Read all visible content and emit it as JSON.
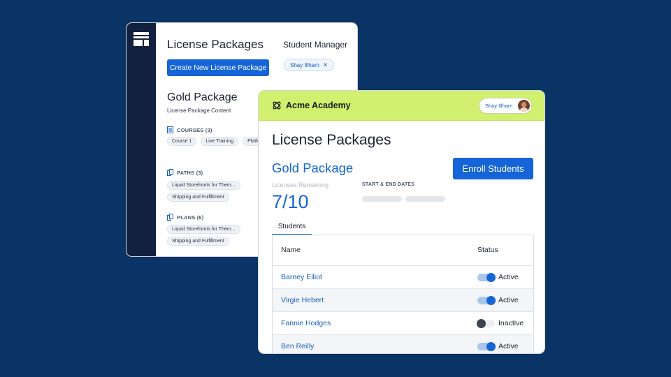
{
  "back_window": {
    "title": "License Packages",
    "create_button": "Create New License Package",
    "manager_label": "Student Manager",
    "manager_chip": "Shay Illham",
    "chip_remove_icon": "close-icon",
    "package_title": "Gold Package",
    "package_subtitle": "License Package Content",
    "sections": [
      {
        "label": "COURSES (3)",
        "icon": "document-icon",
        "items": [
          "Course 1",
          "Live Training",
          "Platform"
        ]
      },
      {
        "label": "PATHS (3)",
        "icon": "stack-icon",
        "items": [
          "Liquid Storefronts for Them...",
          "Shipping and Fulfillment"
        ]
      },
      {
        "label": "PLANS (6)",
        "icon": "stack-icon",
        "items": [
          "Liquid Storefronts for Them...",
          "Shipping and Fulfillment"
        ]
      }
    ]
  },
  "front_window": {
    "brand": "Acme Academy",
    "user_name": "Shay Illham",
    "page_title": "License Packages",
    "package_title": "Gold Package",
    "enroll_button": "Enroll Students",
    "licenses_label": "Licenses Remaining",
    "licenses_count": "7/10",
    "dates_label": "START & END DATES",
    "tab_label": "Students",
    "table": {
      "headers": {
        "name": "Name",
        "status": "Status"
      },
      "rows": [
        {
          "name": "Barney Elliot",
          "status": "Active",
          "on": true
        },
        {
          "name": "Virgie Hebert",
          "status": "Active",
          "on": true
        },
        {
          "name": "Fannie Hodges",
          "status": "Inactive",
          "on": false
        },
        {
          "name": "Ben Reilly",
          "status": "Active",
          "on": true
        }
      ]
    }
  },
  "colors": {
    "background": "#0b3466",
    "primary": "#1565d8",
    "header_accent": "#d2f06f",
    "sidebar": "#12213d"
  }
}
